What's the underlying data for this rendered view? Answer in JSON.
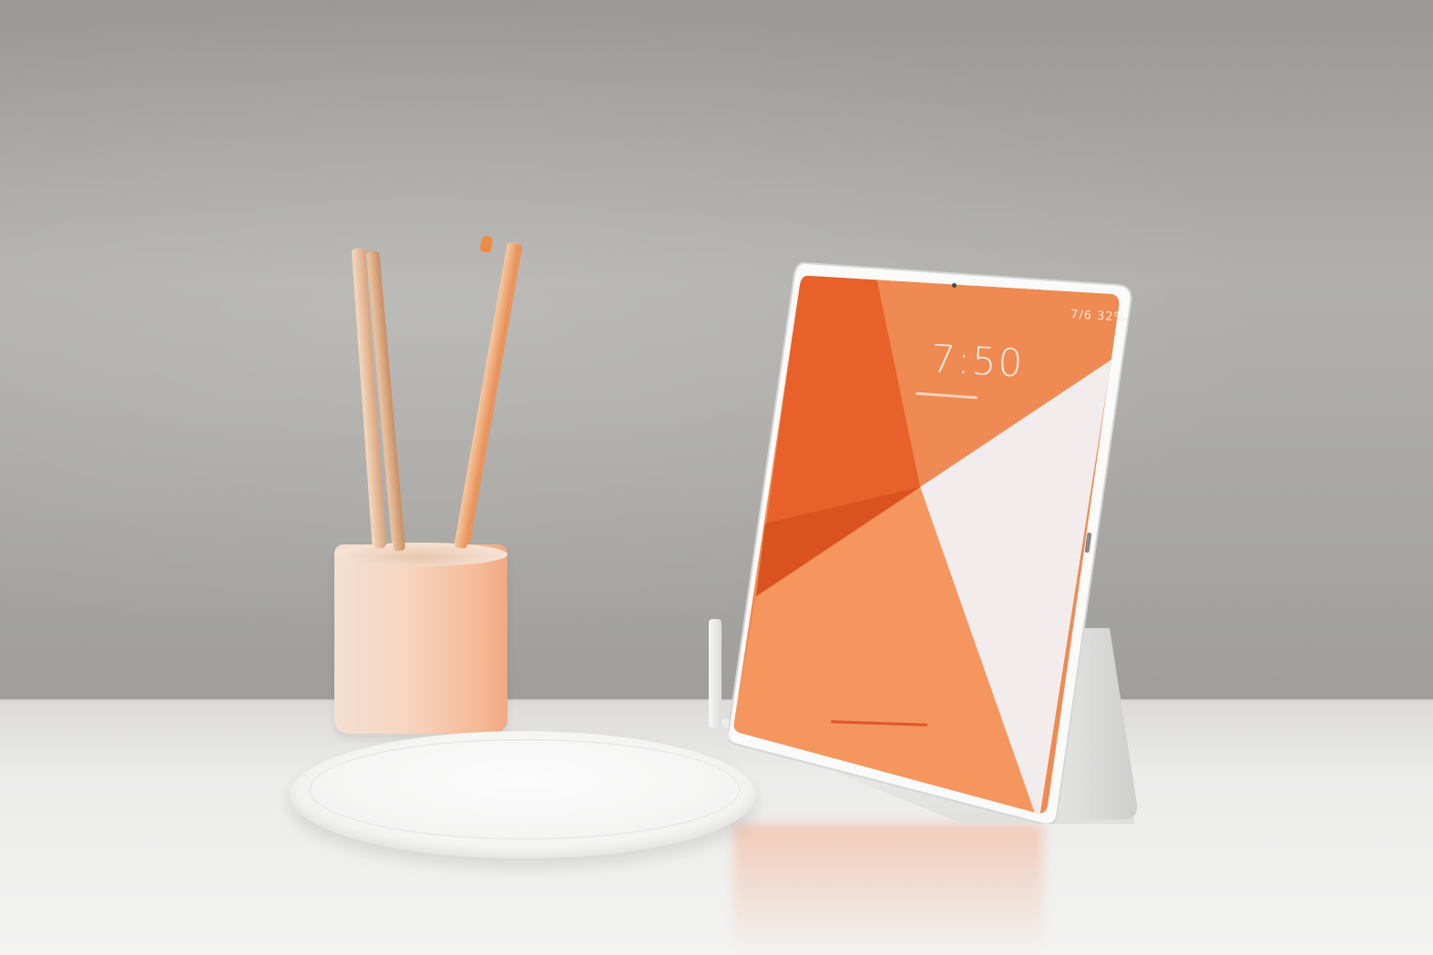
{
  "scene": {
    "description_items": [
      "pencil-cup",
      "pencils",
      "plate",
      "tablet",
      "tablet-stand"
    ],
    "colors": {
      "wall": "#a9a8a4",
      "table": "#ececeb",
      "accent_orange": "#f07a3c",
      "cup": "#f7d6c2"
    }
  },
  "tablet": {
    "status_bar": "7/6 32%",
    "clock": "7:50"
  }
}
